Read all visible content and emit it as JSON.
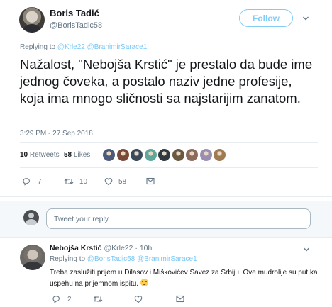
{
  "tweet": {
    "author_name": "Boris Tadić",
    "author_handle": "@BorisTadic58",
    "follow_label": "Follow",
    "replying_prefix": "Replying to",
    "replying_mention_1": "@Krle22",
    "replying_mention_2": "@BranimirSarace1",
    "text": "Nažalost, \"Nebojša Krstić\" je prestalo da bude ime jednog čoveka, a postalo naziv jedne profesije, koja ima mnogo sličnosti sa najstarijim zanatom.",
    "timestamp": "3:29 PM - 27 Sep 2018",
    "retweets_count": "10",
    "retweets_label": "Retweets",
    "likes_count": "58",
    "likes_label": "Likes",
    "likers": [
      "#4a5a78",
      "#7a4a38",
      "#3a4a5a",
      "#5fa89a",
      "#2f3a40",
      "#6b5840",
      "#8c6a5c",
      "#9a8fb0",
      "#a07a50"
    ],
    "actions": {
      "reply_count": "7",
      "retweet_count": "10",
      "like_count": "58"
    }
  },
  "compose": {
    "placeholder": "Tweet your reply"
  },
  "reply": {
    "author_name": "Nebojša Krstić",
    "author_handle": "@Krle22",
    "separator": "·",
    "time": "10h",
    "replying_prefix": "Replying to",
    "replying_mention_1": "@BorisTadic58",
    "replying_mention_2": "@BranimirSarace1",
    "text": "Treba zaslužiti prijem u Đilasov i Miškovićev Savez za Srbiju. Ove mudrolije su put ka uspehu na prijemnom ispitu.",
    "actions": {
      "reply_count": "2"
    }
  },
  "colors": {
    "accent": "#1da1f2",
    "muted": "#657786",
    "text": "#14171a"
  }
}
